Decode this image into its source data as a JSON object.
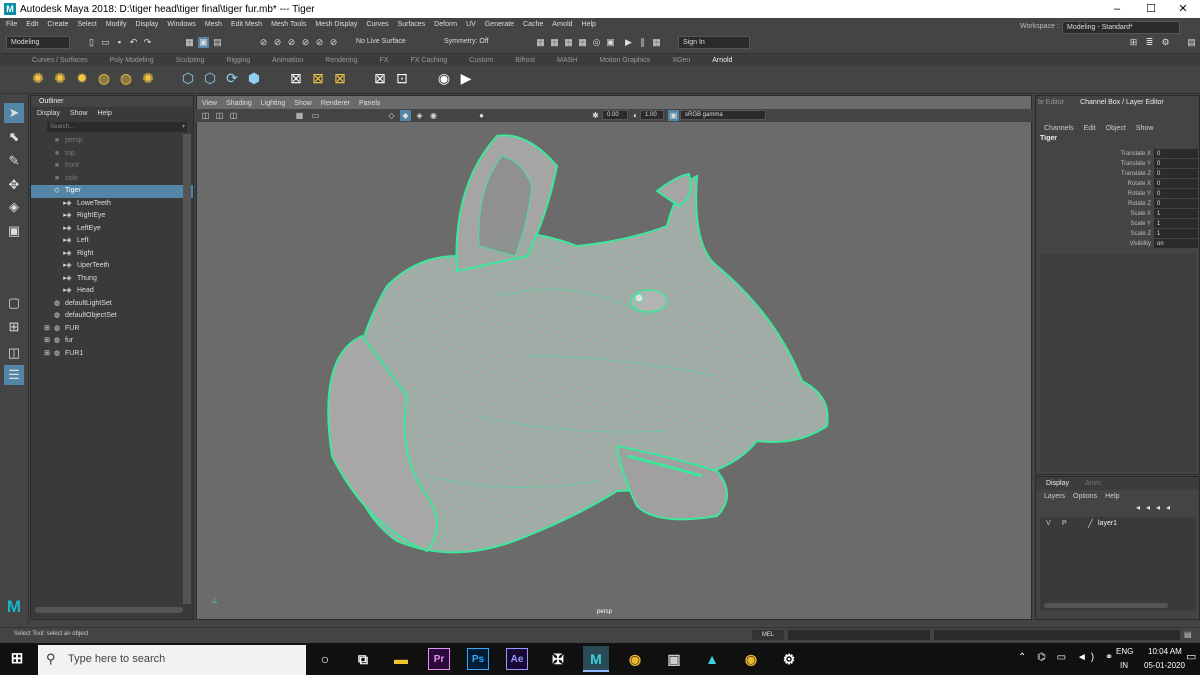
{
  "window": {
    "title": "Autodesk Maya 2018: D:\\tiger head\\tiger final\\tiger fur.mb*   ---   Tiger",
    "minimize": "–",
    "maximize": "☐",
    "close": "✕"
  },
  "menubar": [
    "File",
    "Edit",
    "Create",
    "Select",
    "Modify",
    "Display",
    "Windows",
    "Mesh",
    "Edit Mesh",
    "Mesh Tools",
    "Mesh Display",
    "Curves",
    "Surfaces",
    "Deform",
    "UV",
    "Generate",
    "Cache",
    "Arnold",
    "Help"
  ],
  "statusline": {
    "mode": "Modeling",
    "live_surface": "No Live Surface",
    "symmetry": "Symmetry: Off",
    "sign_in": "Sign In",
    "workspace_label": "Workspace :",
    "workspace": "Modeling - Standard*"
  },
  "shelf_tabs": [
    "Curves / Surfaces",
    "Poly Modeling",
    "Sculpting",
    "Rigging",
    "Animation",
    "Rendering",
    "FX",
    "FX Caching",
    "Custom",
    "Bifrost",
    "MASH",
    "Motion Graphics",
    "XGen",
    "Arnold"
  ],
  "shelf_active": "Arnold",
  "outliner": {
    "title": "Outliner",
    "menu": [
      "Display",
      "Show",
      "Help"
    ],
    "search_placeholder": "Search...",
    "items": [
      {
        "label": "persp",
        "indent": 0,
        "dim": true
      },
      {
        "label": "top",
        "indent": 0,
        "dim": true
      },
      {
        "label": "front",
        "indent": 0,
        "dim": true
      },
      {
        "label": "side",
        "indent": 0,
        "dim": true
      },
      {
        "label": "Tiger",
        "indent": 0,
        "selected": true
      },
      {
        "label": "LoweTeeth",
        "indent": 1
      },
      {
        "label": "RightEye",
        "indent": 1
      },
      {
        "label": "LeftEye",
        "indent": 1
      },
      {
        "label": "Left",
        "indent": 1
      },
      {
        "label": "Right",
        "indent": 1
      },
      {
        "label": "UperTeeth",
        "indent": 1
      },
      {
        "label": "Thung",
        "indent": 1
      },
      {
        "label": "Head",
        "indent": 1
      },
      {
        "label": "defaultLightSet",
        "indent": 0
      },
      {
        "label": "defaultObjectSet",
        "indent": 0
      },
      {
        "label": "FUR",
        "indent": 0
      },
      {
        "label": "fur",
        "indent": 0
      },
      {
        "label": "FUR1",
        "indent": 0
      }
    ]
  },
  "viewport": {
    "menu": [
      "View",
      "Shading",
      "Lighting",
      "Show",
      "Renderer",
      "Panels"
    ],
    "exposure": "0.00",
    "gamma": "1.00",
    "color_space": "sRGB gamma",
    "camera_label": "persp",
    "wire_color": "#3de89a"
  },
  "channelbox": {
    "tabs": [
      "Channel Box / Layer Editor"
    ],
    "left_tab": "te Editor",
    "menu": [
      "Channels",
      "Edit",
      "Object",
      "Show"
    ],
    "object": "Tiger",
    "attrs": [
      {
        "name": "Translate X",
        "value": "0"
      },
      {
        "name": "Translate Y",
        "value": "0"
      },
      {
        "name": "Translate Z",
        "value": "0"
      },
      {
        "name": "Rotate X",
        "value": "0"
      },
      {
        "name": "Rotate Y",
        "value": "0"
      },
      {
        "name": "Rotate Z",
        "value": "0"
      },
      {
        "name": "Scale X",
        "value": "1"
      },
      {
        "name": "Scale Y",
        "value": "1"
      },
      {
        "name": "Scale Z",
        "value": "1"
      },
      {
        "name": "Visibility",
        "value": "on"
      }
    ]
  },
  "layer_editor": {
    "tabs": [
      "Display",
      "Anim"
    ],
    "menu": [
      "Layers",
      "Options",
      "Help"
    ],
    "layer": {
      "v": "V",
      "p": "P",
      "name": "layer1"
    }
  },
  "helpline": {
    "text": "Select Tool: select an object",
    "mel": "MEL"
  },
  "taskbar": {
    "search_placeholder": "Type here to search",
    "lang1": "ENG",
    "lang2": "IN",
    "time": "10:04 AM",
    "date": "05-01-2020",
    "apps": [
      "Pr",
      "Ps",
      "Ae",
      "M"
    ]
  }
}
